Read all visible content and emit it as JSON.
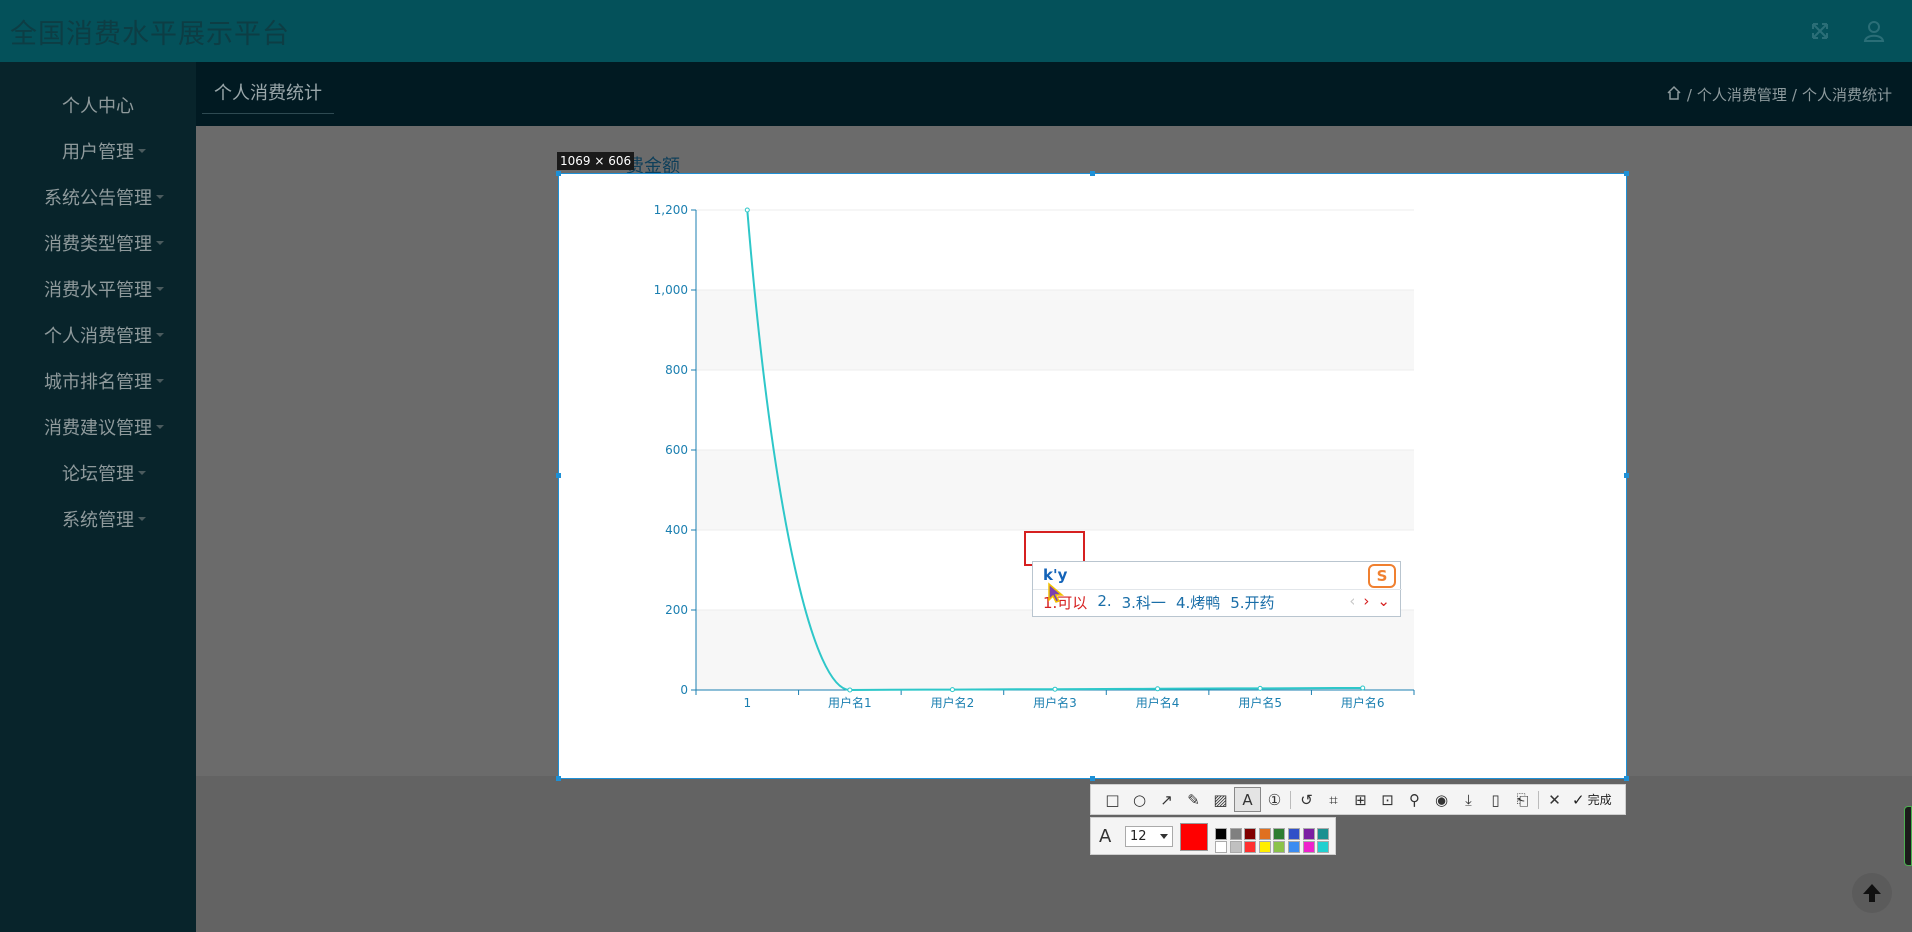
{
  "app": {
    "title": "全国消费水平展示平台"
  },
  "header_icons": [
    "fullscreen-icon",
    "user-icon"
  ],
  "sidebar": {
    "items": [
      {
        "label": "个人中心",
        "has_submenu": false
      },
      {
        "label": "用户管理",
        "has_submenu": true
      },
      {
        "label": "系统公告管理",
        "has_submenu": true
      },
      {
        "label": "消费类型管理",
        "has_submenu": true
      },
      {
        "label": "消费水平管理",
        "has_submenu": true
      },
      {
        "label": "个人消费管理",
        "has_submenu": true
      },
      {
        "label": "城市排名管理",
        "has_submenu": true
      },
      {
        "label": "消费建议管理",
        "has_submenu": true
      },
      {
        "label": "论坛管理",
        "has_submenu": true
      },
      {
        "label": "系统管理",
        "has_submenu": true
      }
    ]
  },
  "page": {
    "tab_label": "个人消费统计",
    "breadcrumb": [
      "个人消费管理",
      "个人消费统计"
    ],
    "breadcrumb_sep": "/",
    "chart_title_visible": "费金额"
  },
  "screenshot_tool": {
    "size_label": "1069 × 606",
    "tools": [
      "rectangle-icon",
      "ellipse-icon",
      "arrow-icon",
      "pencil-icon",
      "mosaic-icon",
      "text-icon",
      "serial-number-icon",
      "undo-icon",
      "ocr-icon",
      "translate-icon",
      "scan-icon",
      "pin-icon",
      "record-icon",
      "download-icon",
      "save-icon",
      "bookmark-icon",
      "close-icon",
      "confirm-icon"
    ],
    "done_label": "完成",
    "font_size": "12",
    "active_color": "#ff0000",
    "palette_top": [
      "#000000",
      "#808080",
      "#800000",
      "#e07020",
      "#2e7d32",
      "#3050c8",
      "#7b1fa2",
      "#1a9090"
    ],
    "palette_bottom": [
      "#ffffff",
      "#c0c0c0",
      "#ff3030",
      "#ffee00",
      "#8bc34a",
      "#3c8cf0",
      "#ee22cc",
      "#22d0d0"
    ]
  },
  "ime": {
    "input": "k'y",
    "candidates": [
      "1.可以",
      "2.",
      "3.科一",
      "4.烤鸭",
      "5.开药"
    ],
    "logo": "S"
  },
  "chart_data": {
    "type": "line",
    "categories": [
      "1",
      "用户名1",
      "用户名2",
      "用户名3",
      "用户名4",
      "用户名5",
      "用户名6"
    ],
    "values": [
      1200,
      0,
      1,
      2,
      3,
      4,
      5
    ],
    "title": "",
    "xlabel": "",
    "ylabel": "",
    "ylim": [
      0,
      1200
    ],
    "yticks": [
      "0",
      "200",
      "400",
      "600",
      "800",
      "1,000",
      "1,200"
    ],
    "line_color": "#2ec7c9",
    "axis_color": "#1b7fb0"
  }
}
